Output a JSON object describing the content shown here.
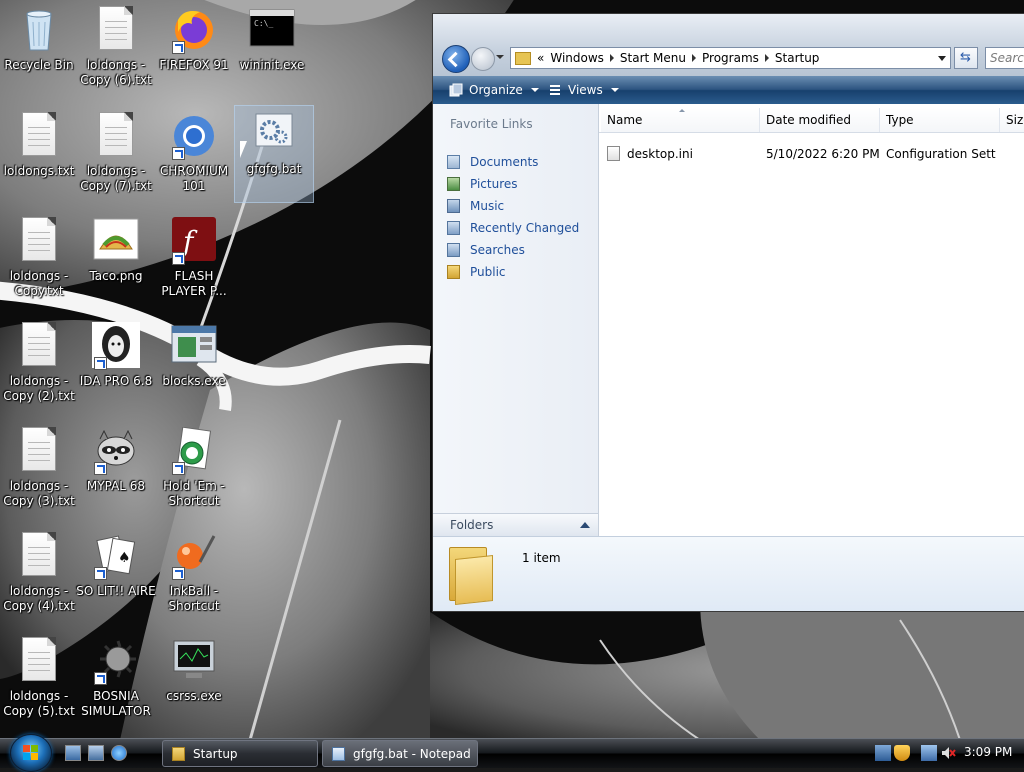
{
  "desktop": {
    "icons": [
      {
        "label": "Recycle Bin"
      },
      {
        "label": "loldongs - Copy (6).txt"
      },
      {
        "label": "FIREFOX 91"
      },
      {
        "label": "wininit.exe"
      },
      {
        "label": "loldongs.txt"
      },
      {
        "label": "loldongs - Copy (7).txt"
      },
      {
        "label": "CHROMIUM 101"
      },
      {
        "label": "gfgfg.bat"
      },
      {
        "label": "loldongs - Copy.txt"
      },
      {
        "label": "Taco.png"
      },
      {
        "label": "FLASH PLAYER P..."
      },
      {
        "label": "loldongs - Copy (2).txt"
      },
      {
        "label": "IDA PRO 6.8"
      },
      {
        "label": "blocks.exe"
      },
      {
        "label": "loldongs - Copy (3).txt"
      },
      {
        "label": "MYPAL 68"
      },
      {
        "label": "Hold 'Em - Shortcut"
      },
      {
        "label": "loldongs - Copy (4).txt"
      },
      {
        "label": "SO LIT!! AIRE"
      },
      {
        "label": "InkBall - Shortcut"
      },
      {
        "label": "loldongs - Copy (5).txt"
      },
      {
        "label": "BOSNIA SIMULATOR"
      },
      {
        "label": "csrss.exe"
      }
    ]
  },
  "explorer": {
    "address": {
      "overflow": "«",
      "crumbs": [
        "Windows",
        "Start Menu",
        "Programs",
        "Startup"
      ]
    },
    "search_placeholder": "Search",
    "commands": {
      "organize": "Organize",
      "views": "Views"
    },
    "nav": {
      "title": "Favorite Links",
      "links": [
        "Documents",
        "Pictures",
        "Music",
        "Recently Changed",
        "Searches",
        "Public"
      ],
      "folders": "Folders"
    },
    "columns": [
      "Name",
      "Date modified",
      "Type",
      "Size"
    ],
    "files": [
      {
        "name": "desktop.ini",
        "date": "5/10/2022 6:20 PM",
        "type": "Configuration Sett..."
      }
    ],
    "details": {
      "count": "1 item"
    }
  },
  "taskbar": {
    "buttons": [
      {
        "label": "Startup"
      },
      {
        "label": "gfgfg.bat - Notepad"
      }
    ],
    "clock": "3:09 PM"
  },
  "colors": {
    "link_blue": "#1f4f9a",
    "cmdbar": "#2d5480",
    "taskbar": "#15181c"
  }
}
